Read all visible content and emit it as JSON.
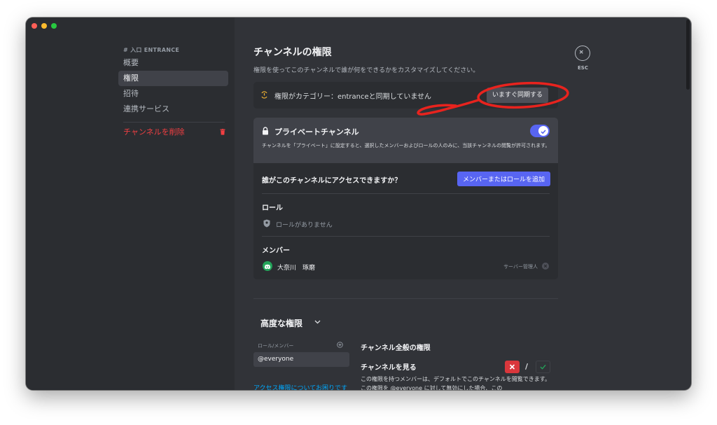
{
  "sidebar": {
    "header": "# 入口 ENTRANCE",
    "items": [
      {
        "label": "概要"
      },
      {
        "label": "権限"
      },
      {
        "label": "招待"
      },
      {
        "label": "連携サービス"
      }
    ],
    "delete_label": "チャンネルを削除"
  },
  "main": {
    "title": "チャンネルの権限",
    "subtitle": "権限を使ってこのチャンネルで誰が何をできるかをカスタマイズしてください。",
    "sync": {
      "text": "権限がカテゴリー：entranceと同期していません",
      "button": "いますぐ同期する"
    },
    "private": {
      "title": "プライベートチャンネル",
      "enabled": true,
      "description": "チャンネルを「プライベート」に設定すると、選択したメンバーおよびロールの人のみに、当該チャンネルの閲覧が許可されます。"
    },
    "access": {
      "question": "誰がこのチャンネルにアクセスできますか？",
      "add_button": "メンバーまたはロールを追加",
      "roles_label": "ロール",
      "roles_empty": "ロールがありません",
      "members_label": "メンバー",
      "member": {
        "name": "大奈川　琢磨",
        "role": "サーバー管理人"
      }
    },
    "advanced": {
      "title": "高度な権限",
      "role_column": "ロール/メンバー",
      "selected_role": "@everyone",
      "help_link": "アクセス権限についてお困りです",
      "section": "チャンネル全般の権限",
      "perm_title": "チャンネルを見る",
      "perm_desc": "この権限を持つメンバーは、デフォルトでこのチャンネルを閲覧できます。この権限を @everyone に対して無効にした場合、この",
      "state": "deny",
      "slash": "/"
    }
  },
  "esc_label": "ESC",
  "colors": {
    "accent": "#5865f2",
    "danger": "#f23f42",
    "annotation": "#e8231e",
    "link": "#00a8fc"
  }
}
